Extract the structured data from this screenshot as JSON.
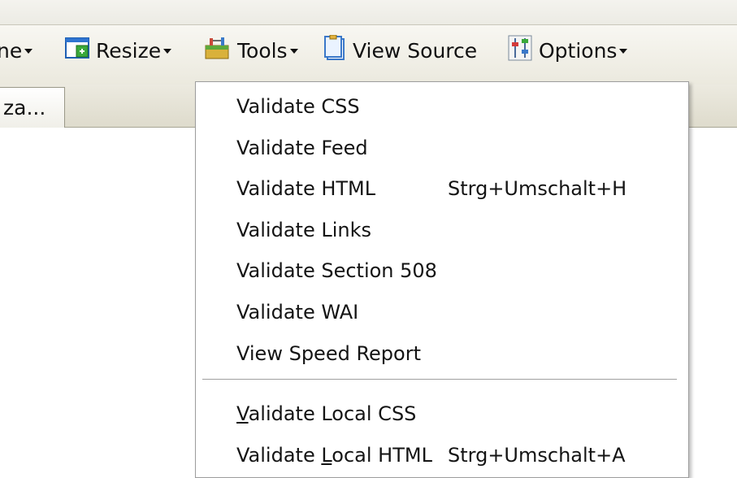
{
  "toolbar": {
    "items": [
      {
        "label": "ne",
        "icon": "partial-dropdown"
      },
      {
        "label": "Resize",
        "icon": "resize-window-icon"
      },
      {
        "label": "Tools",
        "icon": "tools-toolbox-icon"
      },
      {
        "label": "View Source",
        "icon": "view-source-document-icon"
      },
      {
        "label": "Options",
        "icon": "options-sliders-icon"
      }
    ]
  },
  "tab": {
    "label": "za..."
  },
  "menu": {
    "items": [
      {
        "label": "Validate CSS",
        "shortcut": ""
      },
      {
        "label": "Validate Feed",
        "shortcut": ""
      },
      {
        "label": "Validate HTML",
        "shortcut": "Strg+Umschalt+H"
      },
      {
        "label": "Validate Links",
        "shortcut": ""
      },
      {
        "label": "Validate Section 508",
        "shortcut": ""
      },
      {
        "label": "Validate WAI",
        "shortcut": ""
      },
      {
        "label": "View Speed Report",
        "shortcut": ""
      }
    ],
    "local_items": [
      {
        "pre": "",
        "mnemonic": "V",
        "post": "alidate Local CSS",
        "shortcut": ""
      },
      {
        "pre": "Validate ",
        "mnemonic": "L",
        "post": "ocal HTML",
        "shortcut": "Strg+Umschalt+A"
      }
    ]
  },
  "colors": {
    "toolbar_bg": "#ebe9de",
    "menu_bg": "#ffffff",
    "menu_border": "#9d9d9d",
    "text": "#141414"
  }
}
